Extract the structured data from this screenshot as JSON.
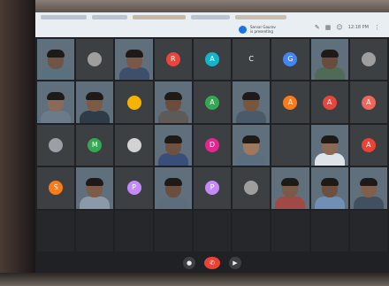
{
  "top_bar": {
    "presenter_line1": "Sarvar Gaurav",
    "presenter_line2": "is presenting",
    "clock": "12:18 PM"
  },
  "tiles": [
    {
      "kind": "video",
      "skin": "#6f5544",
      "shirt": "#59707f"
    },
    {
      "kind": "avatar",
      "letter": "",
      "color": "#9e9e9e"
    },
    {
      "kind": "video",
      "skin": "#7a5847",
      "shirt": "#3d4f6b"
    },
    {
      "kind": "avatar",
      "letter": "R",
      "color": "#e8453c"
    },
    {
      "kind": "avatar",
      "letter": "A",
      "color": "#12b5cb"
    },
    {
      "kind": "avatar",
      "letter": "C",
      "color": "#3c4043"
    },
    {
      "kind": "avatar",
      "letter": "G",
      "color": "#4285f4"
    },
    {
      "kind": "video",
      "skin": "#6a4c3d",
      "shirt": "#4f6b56"
    },
    {
      "kind": "avatar",
      "letter": "",
      "color": "#9e9e9e"
    },
    {
      "kind": "video",
      "skin": "#8a6b5a",
      "shirt": "#6d7a8a"
    },
    {
      "kind": "video",
      "skin": "#7d5a46",
      "shirt": "#2f3b46"
    },
    {
      "kind": "avatar",
      "letter": "",
      "color": "#f4b400"
    },
    {
      "kind": "video",
      "skin": "#6c4d3d",
      "shirt": "#5e5a58"
    },
    {
      "kind": "avatar",
      "letter": "A",
      "color": "#34a853"
    },
    {
      "kind": "video",
      "skin": "#77553f",
      "shirt": "#4a5a6a"
    },
    {
      "kind": "avatar",
      "letter": "A",
      "color": "#fa7b17"
    },
    {
      "kind": "avatar",
      "letter": "A",
      "color": "#e8453c"
    },
    {
      "kind": "avatar",
      "letter": "A",
      "color": "#ee675c"
    },
    {
      "kind": "avatar",
      "letter": "",
      "color": "#9aa0a6"
    },
    {
      "kind": "avatar",
      "letter": "M",
      "color": "#34a853"
    },
    {
      "kind": "avatar",
      "letter": "",
      "color": "#d3d3d3"
    },
    {
      "kind": "video",
      "skin": "#6f5143",
      "shirt": "#3a4e7a"
    },
    {
      "kind": "avatar",
      "letter": "D",
      "color": "#e52592"
    },
    {
      "kind": "video",
      "skin": "#a0785f",
      "shirt": "#5a6e80"
    },
    {
      "kind": "avatar",
      "letter": "",
      "color": "#3c4043"
    },
    {
      "kind": "video",
      "skin": "#8b6a55",
      "shirt": "#dfe4ea"
    },
    {
      "kind": "avatar",
      "letter": "A",
      "color": "#ea4335"
    },
    {
      "kind": "avatar",
      "letter": "S",
      "color": "#fa7b17"
    },
    {
      "kind": "video",
      "skin": "#7c5b47",
      "shirt": "#8a9aa8"
    },
    {
      "kind": "avatar",
      "letter": "P",
      "color": "#c58af9"
    },
    {
      "kind": "video",
      "skin": "#6a4e40",
      "shirt": "#5c6e7c"
    },
    {
      "kind": "avatar",
      "letter": "P",
      "color": "#c58af9"
    },
    {
      "kind": "avatar",
      "letter": "",
      "color": "#9e9e9e"
    },
    {
      "kind": "video",
      "skin": "#7a5a48",
      "shirt": "#a14a45"
    },
    {
      "kind": "video",
      "skin": "#6d5040",
      "shirt": "#6f8fb5"
    },
    {
      "kind": "video",
      "skin": "#80604d",
      "shirt": "#40505e"
    },
    {
      "kind": "empty"
    },
    {
      "kind": "empty"
    },
    {
      "kind": "empty"
    },
    {
      "kind": "empty"
    },
    {
      "kind": "empty"
    },
    {
      "kind": "empty"
    },
    {
      "kind": "empty"
    },
    {
      "kind": "empty"
    },
    {
      "kind": "empty"
    }
  ]
}
